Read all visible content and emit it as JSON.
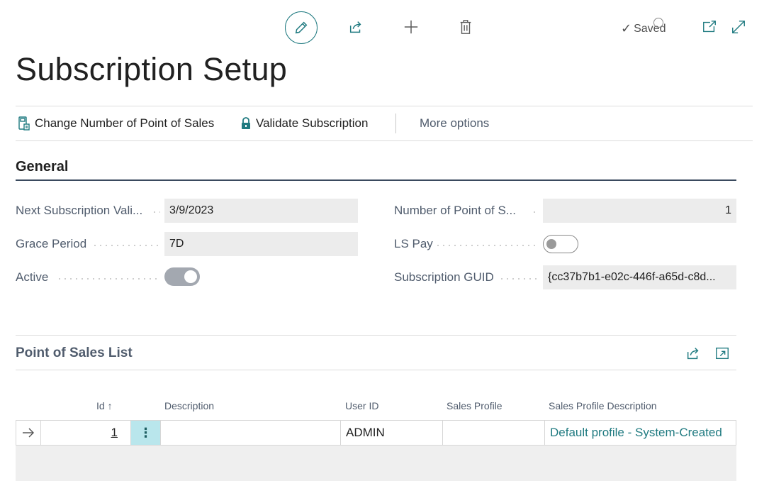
{
  "toolbar": {
    "edit_icon": "pencil-icon",
    "share_icon": "share-icon",
    "new_icon": "plus-icon",
    "delete_icon": "trash-icon",
    "status_text": "Saved",
    "open_new_window_icon": "open-in-new-window-icon",
    "expand_icon": "expand-icon"
  },
  "page": {
    "title": "Subscription Setup"
  },
  "actions": {
    "change_pos": "Change Number of Point of Sales",
    "validate": "Validate Subscription",
    "more": "More options"
  },
  "general": {
    "title": "General",
    "next_subscription_label": "Next Subscription Vali...",
    "next_subscription_value": "3/9/2023",
    "grace_period_label": "Grace Period",
    "grace_period_value": "7D",
    "active_label": "Active",
    "active_value": true,
    "number_pos_label": "Number of Point of S...",
    "number_pos_value": "1",
    "ls_pay_label": "LS Pay",
    "ls_pay_value": false,
    "guid_label": "Subscription GUID",
    "guid_value": "{cc37b7b1-e02c-446f-a65d-c8d..."
  },
  "pos_list": {
    "title": "Point of Sales List",
    "columns": [
      "Id",
      "Description",
      "User ID",
      "Sales Profile",
      "Sales Profile Description"
    ],
    "sort_indicator": "↑",
    "rows": [
      {
        "id": "1",
        "description": "",
        "user_id": "ADMIN",
        "sales_profile": "",
        "sales_profile_description": "Default profile - System-Created"
      }
    ]
  },
  "colors": {
    "accent": "#1f7a80",
    "selected_cell": "#b9e6ec",
    "field_background": "#ececec",
    "section_rule": "#3a4a5e"
  }
}
